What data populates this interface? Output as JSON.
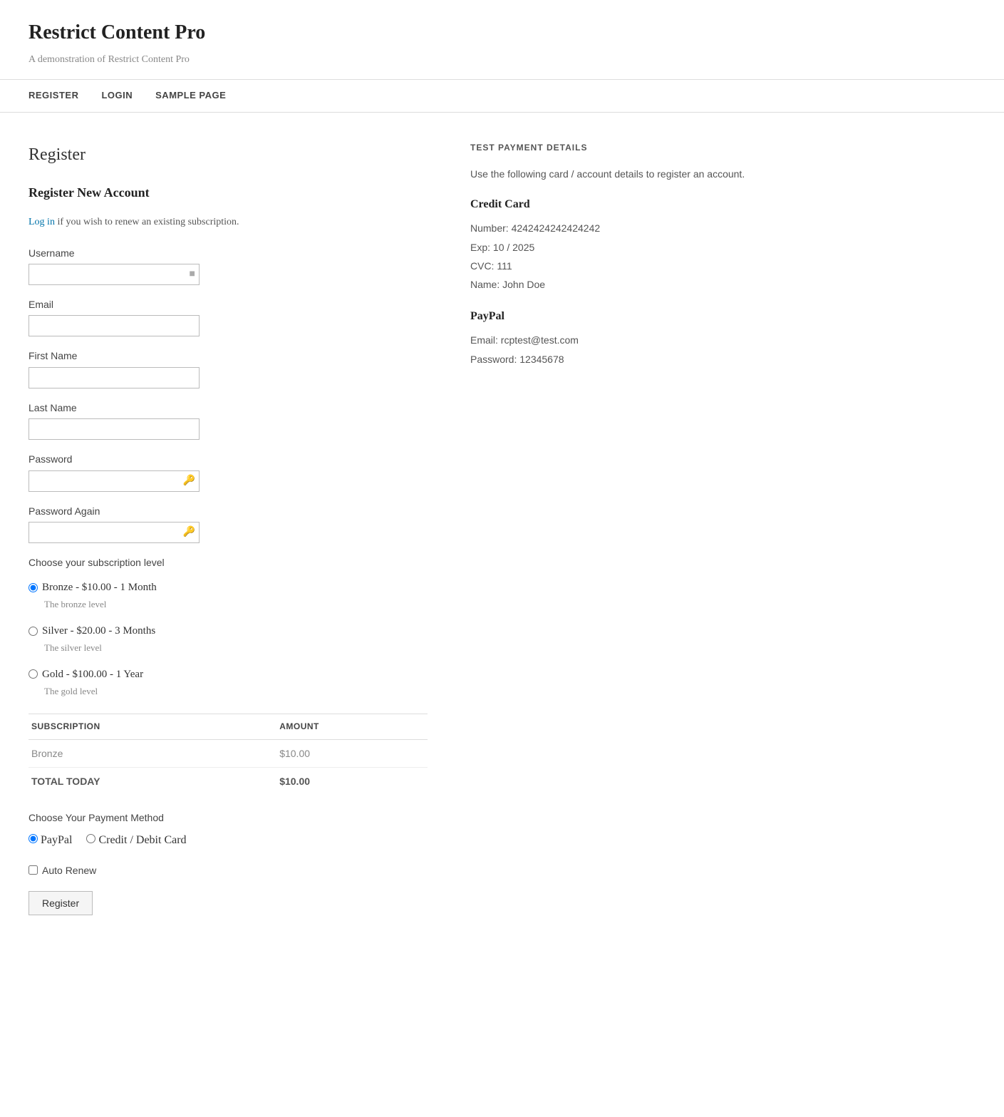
{
  "site": {
    "title": "Restrict Content Pro",
    "tagline": "A demonstration of Restrict Content Pro"
  },
  "nav": {
    "items": [
      {
        "label": "REGISTER",
        "href": "#"
      },
      {
        "label": "LOGIN",
        "href": "#"
      },
      {
        "label": "SAMPLE PAGE",
        "href": "#"
      }
    ]
  },
  "main": {
    "page_heading": "Register",
    "form_section_title": "Register New Account",
    "login_note_text": " if you wish to renew an existing subscription.",
    "login_note_link": "Log in",
    "fields": {
      "username_label": "Username",
      "email_label": "Email",
      "first_name_label": "First Name",
      "last_name_label": "Last Name",
      "password_label": "Password",
      "password_again_label": "Password Again"
    },
    "subscription": {
      "heading": "Choose your subscription level",
      "options": [
        {
          "id": "bronze",
          "label": "Bronze - $10.00 -  1 Month",
          "description": "The bronze level",
          "checked": true
        },
        {
          "id": "silver",
          "label": "Silver - $20.00 -  3 Months",
          "description": "The silver level",
          "checked": false
        },
        {
          "id": "gold",
          "label": "Gold - $100.00 -  1 Year",
          "description": "The gold level",
          "checked": false
        }
      ]
    },
    "table": {
      "col1_header": "SUBSCRIPTION",
      "col2_header": "AMOUNT",
      "row": {
        "name": "Bronze",
        "amount": "$10.00"
      },
      "total_label": "TOTAL TODAY",
      "total_amount": "$10.00"
    },
    "payment": {
      "label": "Choose Your Payment Method",
      "options": [
        {
          "id": "paypal",
          "label": "PayPal",
          "checked": true
        },
        {
          "id": "creditcard",
          "label": "Credit / Debit Card",
          "checked": false
        }
      ]
    },
    "auto_renew": {
      "label": "Auto Renew"
    },
    "register_button": "Register"
  },
  "sidebar": {
    "box_title": "TEST PAYMENT DETAILS",
    "intro_text": "Use the following card / account details to register an account.",
    "credit_card": {
      "title": "Credit Card",
      "number_label": "Number: 4242424242424242",
      "exp_label": "Exp: 10 / 2025",
      "cvc_label": "CVC: 111",
      "name_label": "Name: John Doe"
    },
    "paypal": {
      "title": "PayPal",
      "email_label": "Email: rcptest@test.com",
      "password_label": "Password: 12345678"
    }
  }
}
